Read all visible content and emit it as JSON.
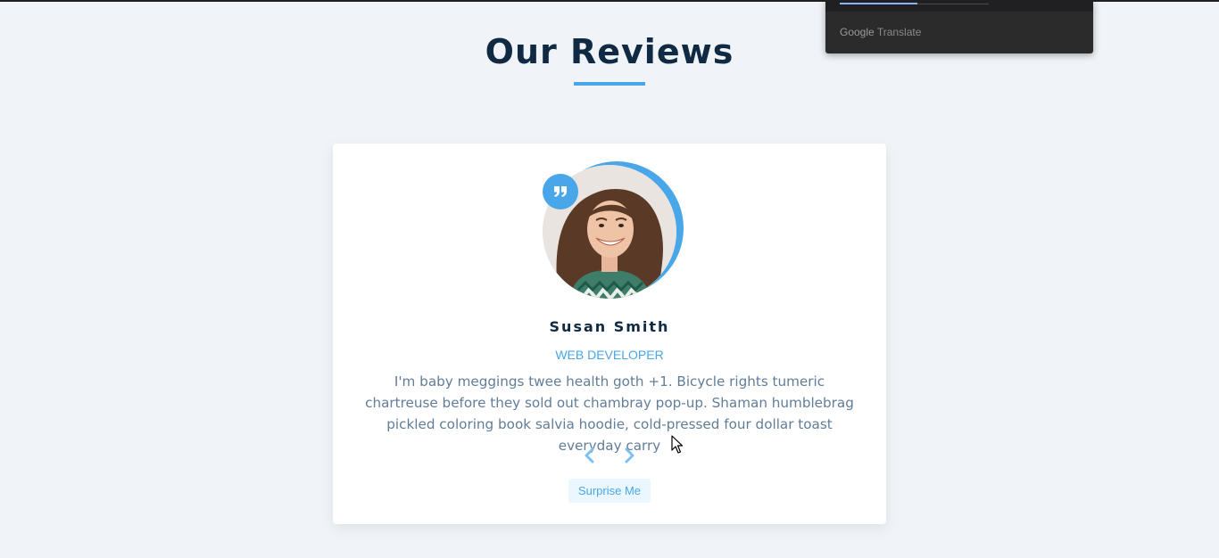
{
  "section": {
    "title": "Our Reviews"
  },
  "review": {
    "author": "Susan Smith",
    "job": "web developer",
    "text": "I'm baby meggings twee health goth +1. Bicycle rights tumeric chartreuse before they sold out chambray pop-up. Shaman humblebrag pickled coloring book salvia hoodie, cold-pressed four dollar toast everyday carry",
    "prev_icon": "chevron-left-icon",
    "next_icon": "chevron-right-icon",
    "random_label": "Surprise Me",
    "quote_icon": "quote-icon"
  },
  "translate_popup": {
    "brand_google": "Google",
    "brand_translate": "Translate"
  },
  "colors": {
    "accent": "#49a6e9",
    "title": "#102a43",
    "text": "#617d98",
    "background": "#f0f4f8",
    "card": "#ffffff",
    "random_bg": "#ebf7ff"
  }
}
